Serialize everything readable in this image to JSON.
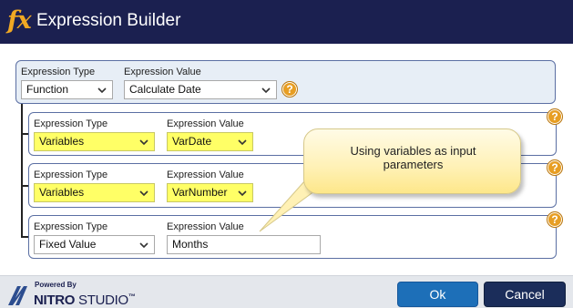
{
  "window": {
    "title": "Expression Builder",
    "icon": "fx",
    "accent_color": "#f0a823",
    "titlebar_color": "#1b2050"
  },
  "main_row": {
    "type_label": "Expression Type",
    "type_value": "Function",
    "value_label": "Expression Value",
    "value_value": "Calculate Date",
    "help_glyph": "?"
  },
  "params": [
    {
      "type_label": "Expression Type",
      "type_value": "Variables",
      "value_label": "Expression Value",
      "value_value": "VarDate",
      "help_glyph": "?"
    },
    {
      "type_label": "Expression Type",
      "type_value": "Variables",
      "value_label": "Expression Value",
      "value_value": "VarNumber",
      "help_glyph": "?"
    },
    {
      "type_label": "Expression Type",
      "type_value": "Fixed Value",
      "value_label": "Expression Value",
      "value_value": "Months",
      "help_glyph": "?"
    }
  ],
  "callout": {
    "line1": "Using variables as input",
    "line2": "parameters"
  },
  "footer": {
    "powered_by": "Powered By",
    "brand_bold": "NITRO",
    "brand_rest": " STUDIO",
    "brand_mark": "™",
    "ok_label": "Ok",
    "cancel_label": "Cancel"
  },
  "colors": {
    "highlight": "#ffff66",
    "help_orange": "#e79e24",
    "ok_blue": "#1d6fb8",
    "cancel_navy": "#1b2d5a"
  }
}
